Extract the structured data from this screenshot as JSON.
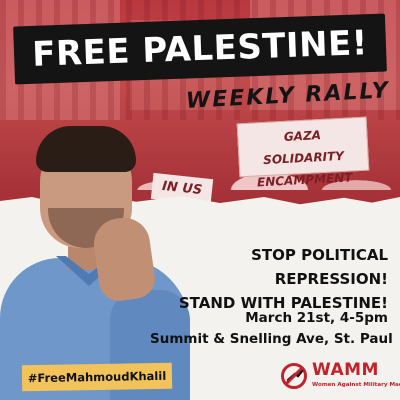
{
  "title": "FREE PALESTINE!",
  "subtitle": "WEEKLY RALLY",
  "photo": {
    "banner_line1": "GAZA SOLIDARITY",
    "banner_line2": "ENCAMPMENT",
    "banner_small": "IN US"
  },
  "headline": {
    "line1": "STOP POLITICAL REPRESSION!",
    "line2": "STAND WITH PALESTINE!"
  },
  "event": {
    "date_time": "March 21st, 4-5pm",
    "location": "Summit & Snelling Ave, St. Paul"
  },
  "hashtag": "#FreeMahmoudKhalil",
  "logo": {
    "name": "WAMM",
    "tagline": "Women Against Military Madness"
  },
  "colors": {
    "accent_red": "#c0232b",
    "photo_tint": "#b8383e",
    "hashtag_yellow": "#f2c25b",
    "title_black": "#141414",
    "paper": "#f4f2ef"
  }
}
